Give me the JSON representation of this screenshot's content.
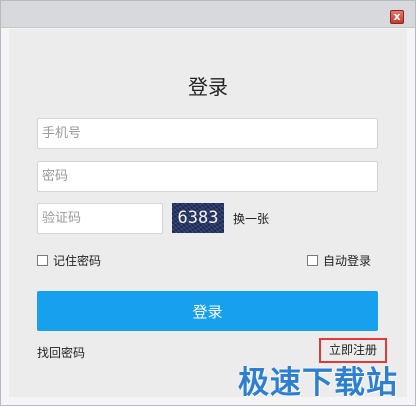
{
  "window": {
    "close_glyph": "x"
  },
  "form": {
    "title": "登录",
    "phone_placeholder": "手机号",
    "password_placeholder": "密码",
    "captcha_placeholder": "验证码",
    "captcha_text": "6383",
    "refresh_label": "换一张",
    "remember_label": "记住密码",
    "autologin_label": "自动登录",
    "login_label": "登录",
    "forgot_label": "找回密码",
    "register_label": "立即注册"
  },
  "watermark": "极速下载站",
  "colors": {
    "accent": "#17a0ee",
    "highlight_border": "#e03a3a",
    "watermark": "#2f7fd1"
  }
}
